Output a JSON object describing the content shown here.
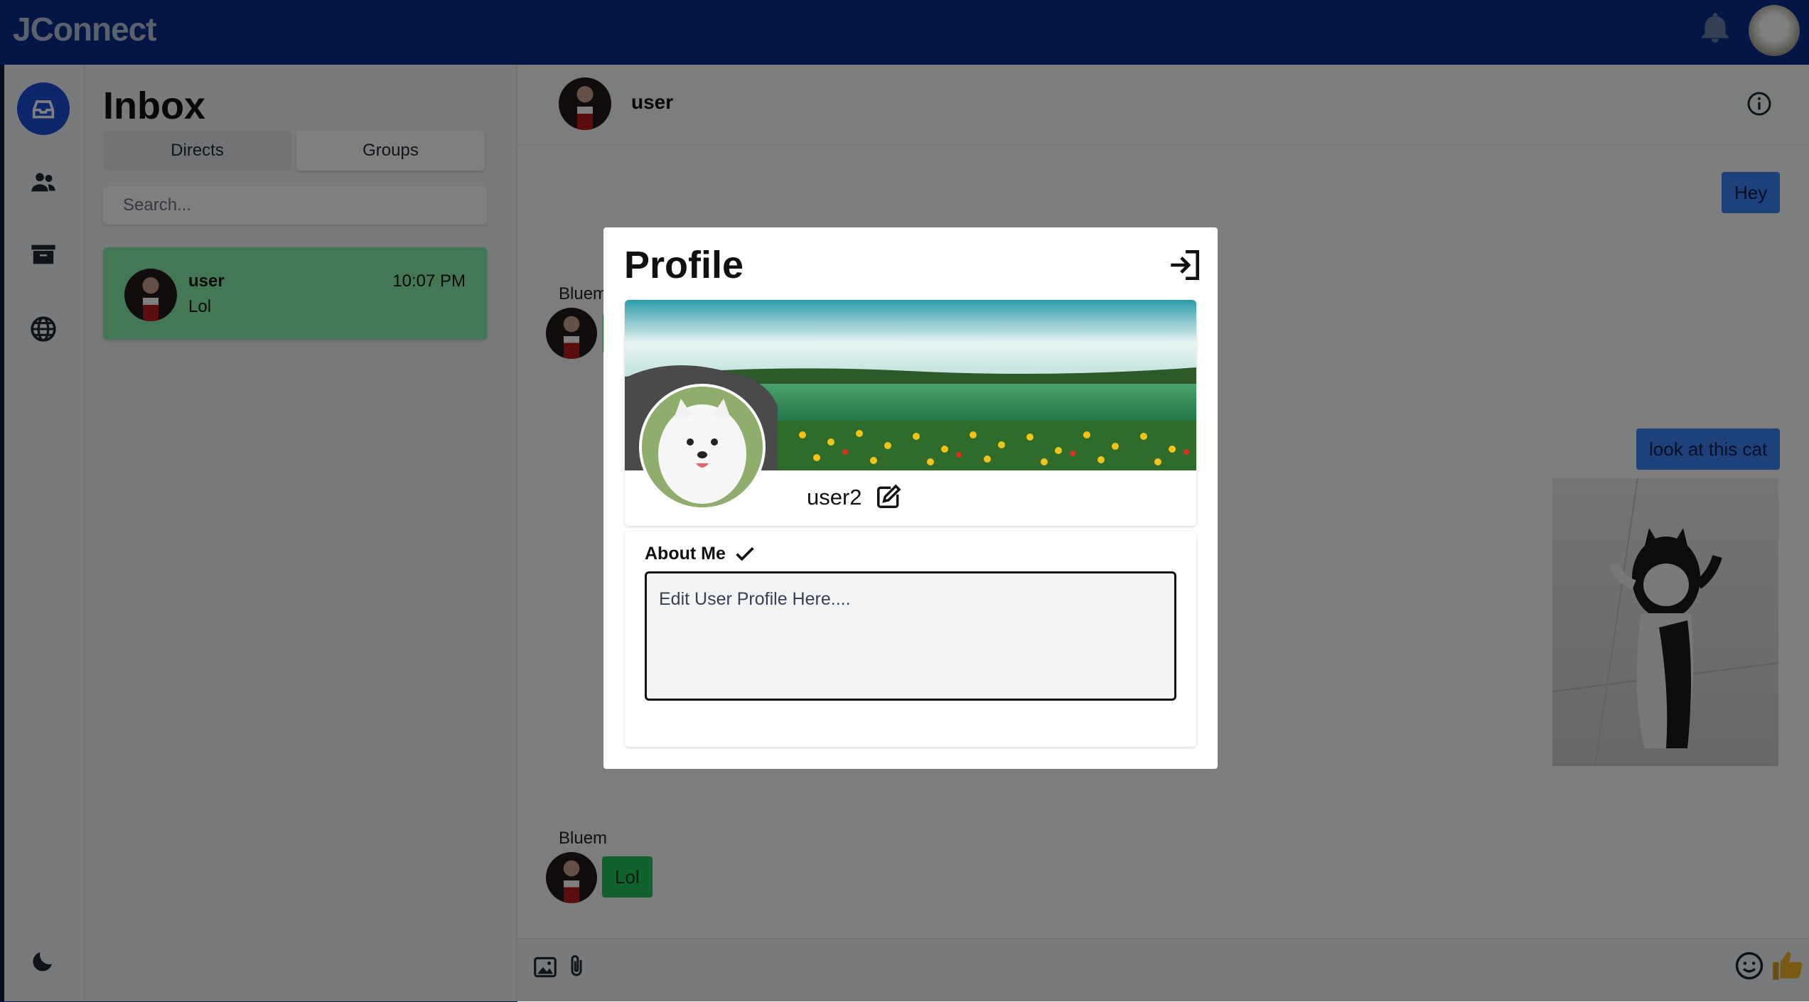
{
  "app": {
    "brand": "JConnect"
  },
  "inbox": {
    "title": "Inbox",
    "tabs": [
      {
        "label": "Directs"
      },
      {
        "label": "Groups"
      }
    ],
    "search_placeholder": "Search...",
    "conversations": [
      {
        "name": "user",
        "time": "10:07 PM",
        "last_message": "Lol"
      }
    ]
  },
  "chat": {
    "header_name": "user",
    "messages": [
      {
        "direction": "out",
        "text": "Hey"
      },
      {
        "direction": "in",
        "sender": "Bluem",
        "text": ""
      },
      {
        "direction": "out",
        "text": "look at this cat"
      },
      {
        "direction": "in",
        "sender": "Bluem",
        "text": "Lol"
      }
    ]
  },
  "modal": {
    "title": "Profile",
    "username": "user2",
    "about_label": "About Me",
    "about_text": "Edit User Profile Here...."
  },
  "colors": {
    "topbar": "#0a2a8c",
    "active": "#1d4ed8",
    "outgoing": "#3b82f6",
    "incoming": "#22c55e",
    "selected_conversation": "#86efac"
  },
  "icons": [
    "bell-icon",
    "inbox-icon",
    "users-icon",
    "archive-icon",
    "globe-icon",
    "moon-icon",
    "info-icon",
    "image-icon",
    "paperclip-icon",
    "smile-icon",
    "thumbs-up-icon",
    "exit-icon",
    "edit-icon",
    "check-icon"
  ]
}
